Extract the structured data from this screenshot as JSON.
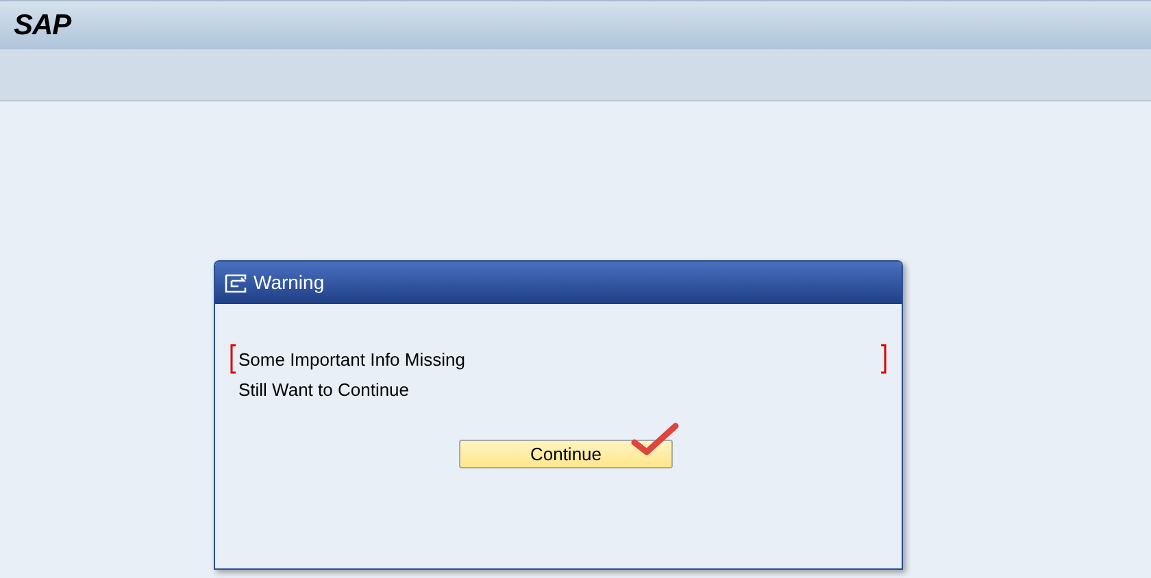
{
  "header": {
    "logo": "SAP"
  },
  "dialog": {
    "title": "Warning",
    "messages": [
      "Some Important Info Missing",
      "Still Want to Continue"
    ],
    "focused": true,
    "button": {
      "label": "Continue",
      "marked": true
    }
  }
}
